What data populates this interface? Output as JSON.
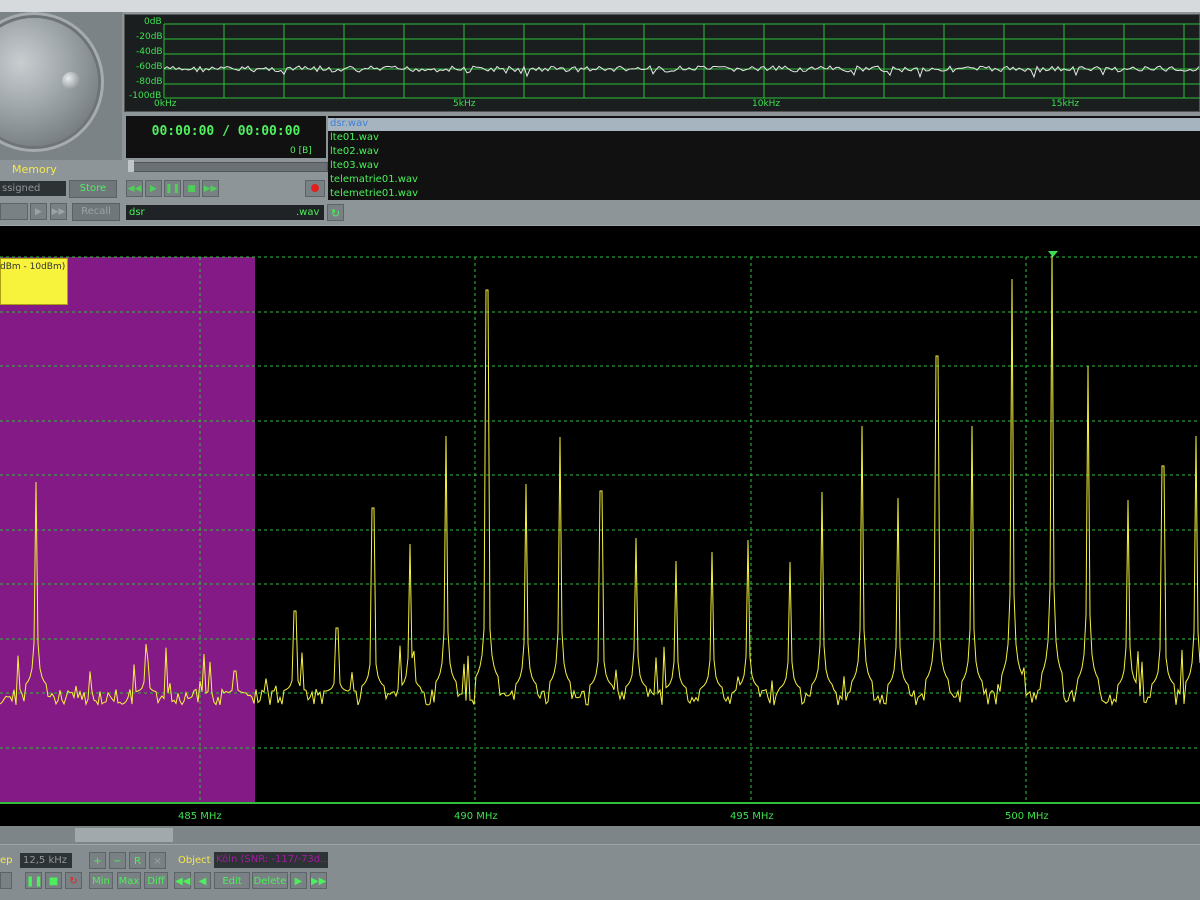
{
  "memory": {
    "label": "Memory",
    "assigned_value": "ssigned",
    "store_label": "Store",
    "recall_label": "Recall"
  },
  "scope": {
    "db_labels": [
      "0dB",
      "-20dB",
      "-40dB",
      "-60dB",
      "-80dB",
      "-100dB"
    ],
    "freq_labels": [
      "0kHz",
      "5kHz",
      "10kHz",
      "15kHz"
    ]
  },
  "player": {
    "time": "00:00:00 / 00:00:00",
    "bytes": "0 [B]",
    "file_name": "dsr",
    "file_ext": ".wav",
    "files": [
      "dsr.wav",
      "lte01.wav",
      "lte02.wav",
      "lte03.wav",
      "telematrie01.wav",
      "telemetrie01.wav"
    ]
  },
  "spectrum": {
    "range_label": "dBm - 10dBm)",
    "freq_labels": [
      "485 MHz",
      "490 MHz",
      "495 MHz",
      "500 MHz"
    ]
  },
  "bottom": {
    "step_label": "ep",
    "step_value": "12,5 kHz",
    "object_label": "Object",
    "object_value": "Köln (SNR: -117/-73d...",
    "min_label": "Min",
    "max_label": "Max",
    "diff_label": "Diff",
    "edit_label": "Edit",
    "delete_label": "Delete"
  },
  "colors": {
    "trace": "#f7f23b",
    "grid": "#2fbf3a",
    "highlight": "#8b1b8c",
    "text_green": "#4cf05a"
  }
}
